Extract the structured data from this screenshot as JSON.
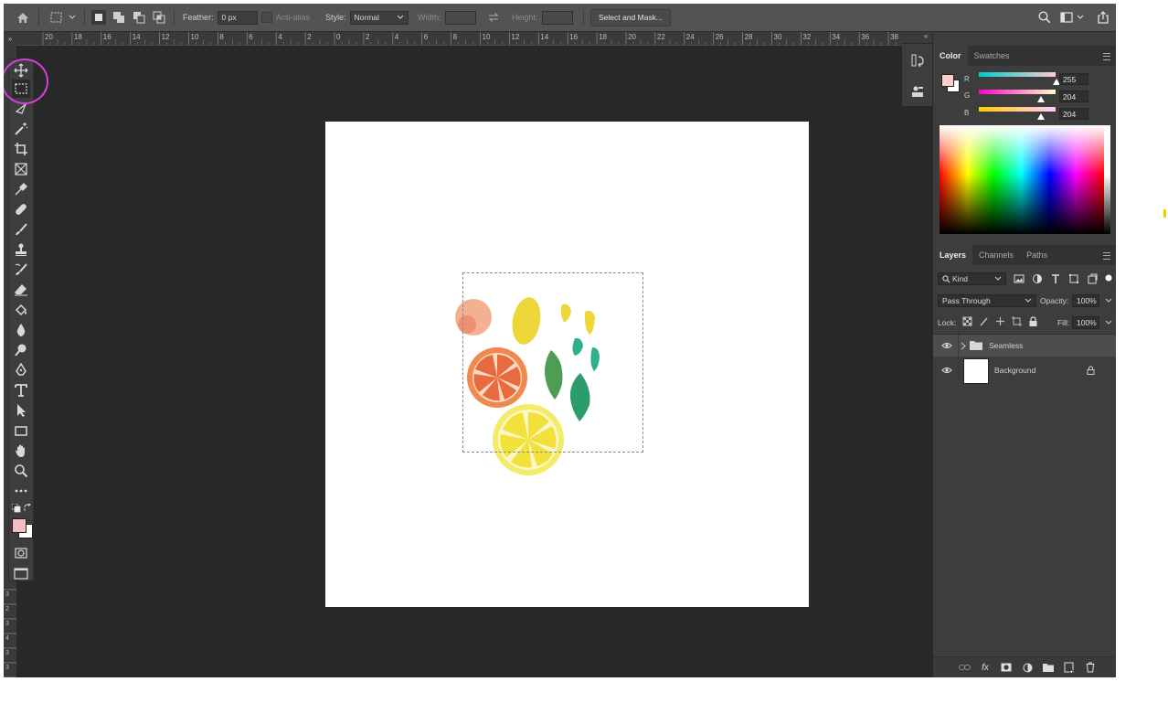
{
  "options_bar": {
    "feather_label": "Feather:",
    "feather_value": "0 px",
    "anti_alias_label": "Anti-alias",
    "style_label": "Style:",
    "style_value": "Normal",
    "width_label": "Width:",
    "height_label": "Height:",
    "select_and_mask": "Select and Mask..."
  },
  "ruler": {
    "h_ticks": [
      "20",
      "18",
      "16",
      "14",
      "12",
      "10",
      "8",
      "6",
      "4",
      "2",
      "0",
      "2",
      "4",
      "6",
      "8",
      "10",
      "12",
      "14",
      "16",
      "18",
      "20",
      "22",
      "24",
      "26",
      "28",
      "30",
      "32",
      "34",
      "36",
      "38"
    ],
    "v_ticks": [
      "3",
      "2",
      "3",
      "4",
      "3",
      "3",
      "4"
    ]
  },
  "toolbar": {
    "tools": [
      "move-tool",
      "marquee-tool",
      "lasso-tool",
      "magic-wand-tool",
      "crop-tool",
      "frame-tool",
      "eyedropper-tool",
      "healing-brush-tool",
      "brush-tool",
      "clone-stamp-tool",
      "history-brush-tool",
      "eraser-tool",
      "paint-bucket-tool",
      "blur-tool",
      "dodge-tool",
      "pen-tool",
      "type-tool",
      "path-selection-tool",
      "rectangle-tool",
      "hand-tool",
      "zoom-tool",
      "more-tools"
    ],
    "active_tool": "marquee-tool",
    "foreground_color": "#f4bdbf",
    "background_color": "#ffffff",
    "highlight_color": "#d640d6"
  },
  "color_panel": {
    "tabs": [
      "Color",
      "Swatches"
    ],
    "channels": [
      {
        "name": "R",
        "value": "255",
        "level": 1.0
      },
      {
        "name": "G",
        "value": "204",
        "level": 0.8
      },
      {
        "name": "B",
        "value": "204",
        "level": 0.8
      }
    ],
    "foreground_color": "#ffcccc"
  },
  "layers_panel": {
    "tabs": [
      "Layers",
      "Channels",
      "Paths"
    ],
    "filter_kind": "Kind",
    "blend_mode": "Pass Through",
    "opacity_label": "Opacity:",
    "opacity_value": "100%",
    "lock_label": "Lock:",
    "fill_label": "Fill:",
    "fill_value": "100%",
    "layers": [
      {
        "name": "Seamless",
        "type": "group",
        "selected": true
      },
      {
        "name": "Background",
        "type": "pixel",
        "locked": true
      }
    ]
  }
}
